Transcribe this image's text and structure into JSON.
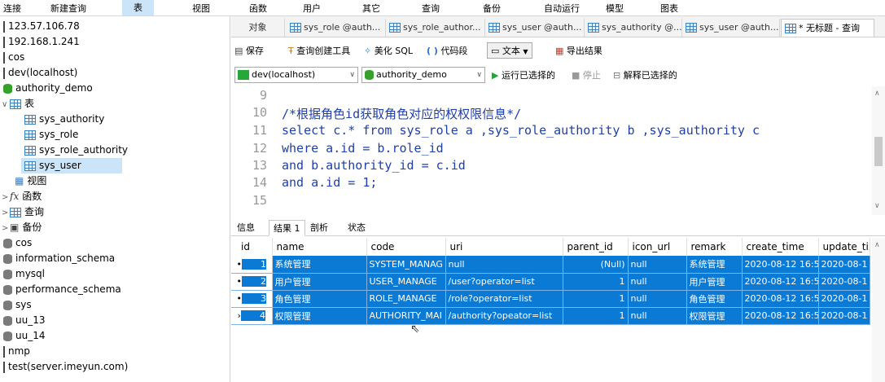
{
  "menu": [
    {
      "label": "连接"
    },
    {
      "label": "新建查询"
    },
    {
      "label": "表"
    },
    {
      "label": "视图"
    },
    {
      "label": "函数"
    },
    {
      "label": "用户"
    },
    {
      "label": "其它"
    },
    {
      "label": "查询"
    },
    {
      "label": "备份"
    },
    {
      "label": "自动运行"
    },
    {
      "label": "模型"
    },
    {
      "label": "图表"
    }
  ],
  "sidebar": {
    "items": [
      {
        "label": "123.57.106.78",
        "icon": "connection-bar-icon"
      },
      {
        "label": "192.168.1.241",
        "icon": "connection-bar-icon"
      },
      {
        "label": "cos",
        "icon": "connection-bar-icon"
      },
      {
        "label": "dev(localhost)",
        "icon": "connection-bar-icon"
      },
      {
        "label": "authority_demo",
        "icon": "database-open-icon"
      },
      {
        "label": "表",
        "icon": "tables-folder-icon",
        "chevron": "∨"
      },
      {
        "label": "sys_authority",
        "icon": "table-icon"
      },
      {
        "label": "sys_role",
        "icon": "table-icon"
      },
      {
        "label": "sys_role_authority",
        "icon": "table-icon"
      },
      {
        "label": "sys_user",
        "icon": "table-icon"
      },
      {
        "label": "视图",
        "icon": "views-icon"
      },
      {
        "label": "函数",
        "icon": "function-icon",
        "chevron": ">"
      },
      {
        "label": "查询",
        "icon": "query-icon",
        "chevron": ">"
      },
      {
        "label": "备份",
        "icon": "backup-icon",
        "chevron": ">"
      },
      {
        "label": "cos",
        "icon": "database-icon"
      },
      {
        "label": "information_schema",
        "icon": "database-icon"
      },
      {
        "label": "mysql",
        "icon": "database-icon"
      },
      {
        "label": "performance_schema",
        "icon": "database-icon"
      },
      {
        "label": "sys",
        "icon": "database-icon"
      },
      {
        "label": "uu_13",
        "icon": "database-icon"
      },
      {
        "label": "uu_14",
        "icon": "database-icon"
      },
      {
        "label": "nmp",
        "icon": "connection-bar-icon"
      },
      {
        "label": "test(server.imeyun.com)",
        "icon": "connection-bar-icon"
      }
    ]
  },
  "tabs": {
    "object_label": "对象",
    "items": [
      {
        "label": "sys_role @auth..."
      },
      {
        "label": "sys_role_author..."
      },
      {
        "label": "sys_user @auth..."
      },
      {
        "label": "sys_authority @..."
      },
      {
        "label": "sys_user @auth..."
      },
      {
        "label": "* 无标题 - 查询"
      }
    ]
  },
  "toolbar": {
    "save": "保存",
    "query_builder": "查询创建工具",
    "beautify": "美化 SQL",
    "snippet": "代码段",
    "text": "文本",
    "export": "导出结果"
  },
  "connbar": {
    "connection": "dev(localhost)",
    "database": "authority_demo",
    "run_selected": "运行已选择的",
    "stop": "停止",
    "explain": "解释已选择的"
  },
  "editor": {
    "line_numbers": [
      "9",
      "10",
      "11",
      "12",
      "13",
      "14",
      "15"
    ],
    "lines": [
      "",
      "/*根据角色id获取角色对应的权权限信息*/",
      "select c.* from sys_role a ,sys_role_authority b ,sys_authority c",
      "where a.id = b.role_id",
      "and b.authority_id = c.id",
      "and a.id = 1;",
      ""
    ]
  },
  "result_tabs": [
    {
      "label": "信息"
    },
    {
      "label": "结果 1"
    },
    {
      "label": "剖析"
    },
    {
      "label": "状态"
    }
  ],
  "grid": {
    "columns": [
      "id",
      "name",
      "code",
      "uri",
      "parent_id",
      "icon_url",
      "remark",
      "create_time",
      "update_tin"
    ],
    "rows": [
      {
        "marker": "•",
        "cells": [
          "1",
          "系统管理",
          "SYSTEM_MANAG",
          "null",
          "(Null)",
          "null",
          "系统管理",
          "2020-08-12 16:5",
          "2020-08-1"
        ]
      },
      {
        "marker": "•",
        "cells": [
          "2",
          "用户管理",
          "USER_MANAGE",
          "/user?operator=list",
          "1",
          "null",
          "用户管理",
          "2020-08-12 16:5",
          "2020-08-1"
        ]
      },
      {
        "marker": "•",
        "cells": [
          "3",
          "角色管理",
          "ROLE_MANAGE",
          "/role?operator=list",
          "1",
          "null",
          "角色管理",
          "2020-08-12 16:5",
          "2020-08-1"
        ]
      },
      {
        "marker": "›",
        "cells": [
          "4",
          "权限管理",
          "AUTHORITY_MAI",
          "/authority?opeator=list",
          "1",
          "null",
          "权限管理",
          "2020-08-12 16:5",
          "2020-08-1"
        ]
      }
    ]
  },
  "colors": {
    "selection": "#0a7ad5",
    "tree_selected": "#cce4f7",
    "sql_blue": "#1f3fa8",
    "db_icon": "#7a7a7a",
    "db_icon_active": "#35a02a"
  }
}
